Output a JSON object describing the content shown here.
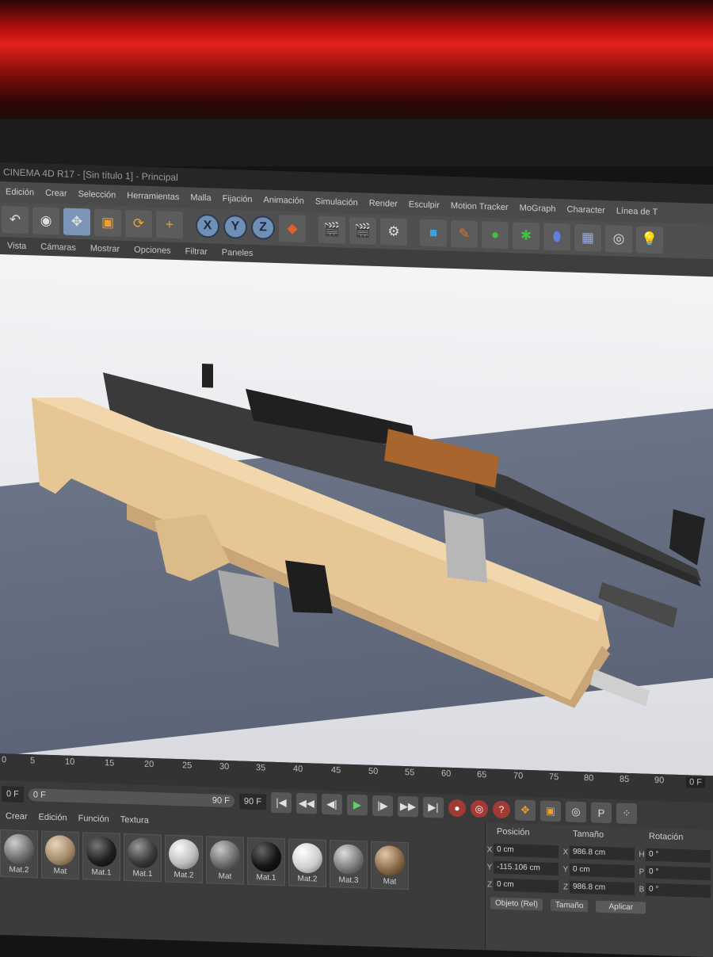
{
  "window": {
    "title": "CINEMA 4D R17 - [Sin título 1] - Principal"
  },
  "menubar": [
    "Edición",
    "Crear",
    "Selección",
    "Herramientas",
    "Malla",
    "Fijación",
    "Animación",
    "Simulación",
    "Render",
    "Esculpir",
    "Motion Tracker",
    "MoGraph",
    "Character",
    "Línea de T"
  ],
  "toolbar": {
    "axis": [
      "X",
      "Y",
      "Z"
    ]
  },
  "viewport_menu": [
    "Vista",
    "Cámaras",
    "Mostrar",
    "Opciones",
    "Filtrar",
    "Paneles"
  ],
  "timeline": {
    "ticks": [
      "0",
      "5",
      "10",
      "15",
      "20",
      "25",
      "30",
      "35",
      "40",
      "45",
      "50",
      "55",
      "60",
      "65",
      "70",
      "75",
      "80",
      "85",
      "90"
    ],
    "current_frame": "0 F"
  },
  "transport": {
    "start": "0 F",
    "slider_left": "0 F",
    "slider_right": "90 F",
    "end": "90 F"
  },
  "materials": {
    "menu": [
      "Crear",
      "Edición",
      "Función",
      "Textura"
    ],
    "items": [
      {
        "label": "Mat.2",
        "color": "#6e6e6e"
      },
      {
        "label": "Mat",
        "color": "#a48c6c"
      },
      {
        "label": "Mat.1",
        "color": "#202020"
      },
      {
        "label": "Mat.1",
        "color": "#3a3a3a"
      },
      {
        "label": "Mat.2",
        "color": "#bdbdbd"
      },
      {
        "label": "Mat",
        "color": "#6a6a6a"
      },
      {
        "label": "Mat.1",
        "color": "#151515"
      },
      {
        "label": "Mat.2",
        "color": "#cfcfcf"
      },
      {
        "label": "Mat.3",
        "color": "#7a7a7a"
      },
      {
        "label": "Mat",
        "color": "#8a6a48"
      }
    ]
  },
  "coords": {
    "headers": [
      "Posición",
      "Tamaño",
      "Rotación"
    ],
    "rows": [
      {
        "axis": "X",
        "pos": "0 cm",
        "size_axis": "X",
        "size": "986.8 cm",
        "rot_axis": "H",
        "rot": "0 °"
      },
      {
        "axis": "Y",
        "pos": "-115.106 cm",
        "size_axis": "Y",
        "size": "0 cm",
        "rot_axis": "P",
        "rot": "0 °"
      },
      {
        "axis": "Z",
        "pos": "0 cm",
        "size_axis": "Z",
        "size": "986.8 cm",
        "rot_axis": "B",
        "rot": "0 °"
      }
    ],
    "mode": "Objeto (Rel)",
    "size_mode": "Tamaño",
    "apply": "Aplicar"
  }
}
